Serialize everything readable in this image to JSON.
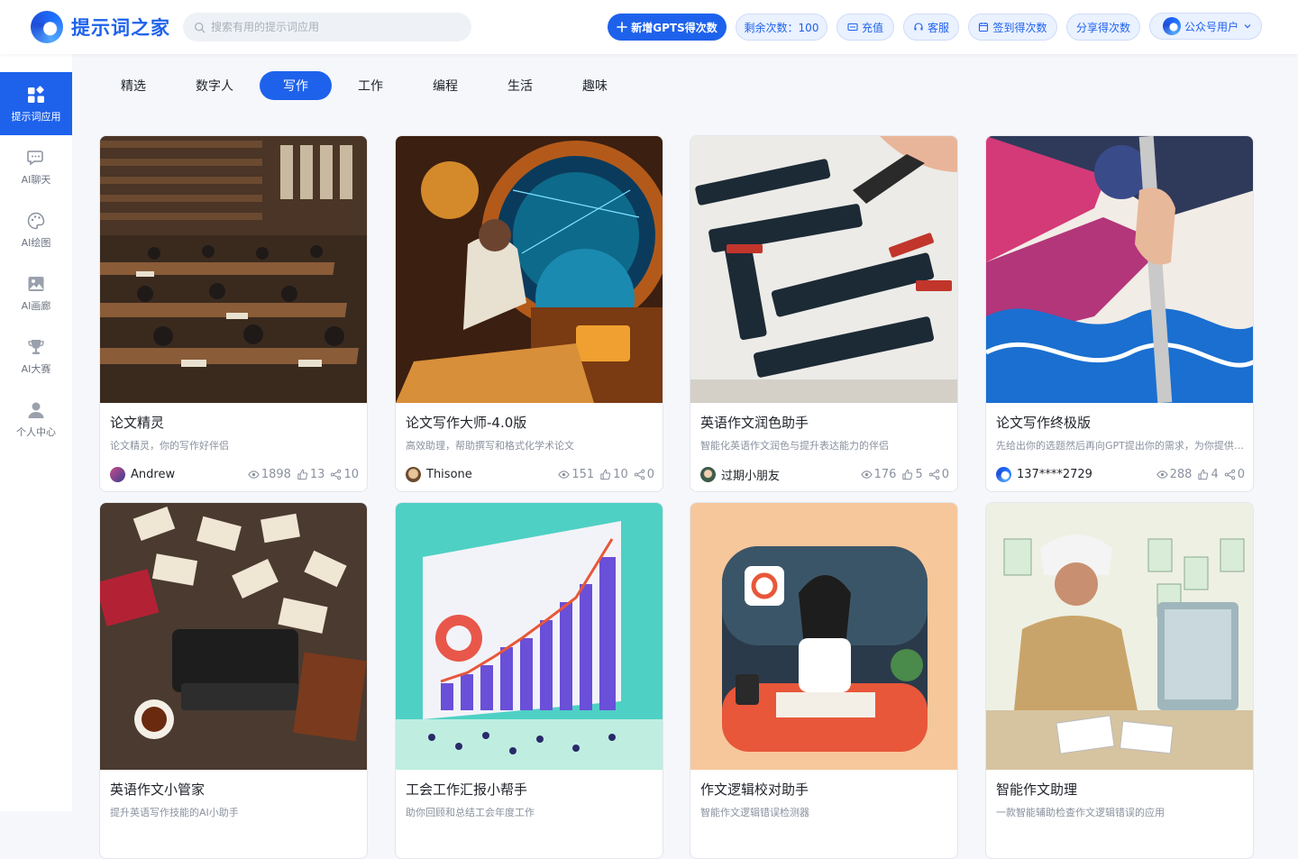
{
  "brand": {
    "name": "提示词之家"
  },
  "search": {
    "placeholder": "搜索有用的提示词应用"
  },
  "header_buttons": {
    "add_gpts": "新增GPTS得次数",
    "remaining": "剩余次数：100",
    "recharge": "充值",
    "service": "客服",
    "checkin": "签到得次数",
    "share": "分享得次数",
    "user": "公众号用户"
  },
  "sidebar": {
    "items": [
      {
        "label": "提示词应用",
        "icon": "grid-icon"
      },
      {
        "label": "AI聊天",
        "icon": "chat-icon"
      },
      {
        "label": "AI绘图",
        "icon": "palette-icon"
      },
      {
        "label": "AI画廊",
        "icon": "gallery-icon"
      },
      {
        "label": "AI大赛",
        "icon": "trophy-icon"
      },
      {
        "label": "个人中心",
        "icon": "person-icon"
      }
    ]
  },
  "tabs": [
    "精选",
    "数字人",
    "写作",
    "工作",
    "编程",
    "生活",
    "趣味"
  ],
  "active_tab": "写作",
  "cards": [
    {
      "title": "论文精灵",
      "desc": "论文精灵，你的写作好伴侣",
      "author": "Andrew",
      "views": "1898",
      "likes": "13",
      "shares": "10"
    },
    {
      "title": "论文写作大师-4.0版",
      "desc": "高效助理，帮助撰写和格式化学术论文",
      "author": "Thisone",
      "views": "151",
      "likes": "10",
      "shares": "0"
    },
    {
      "title": "英语作文润色助手",
      "desc": "智能化英语作文润色与提升表达能力的伴侣",
      "author": "过期小朋友",
      "views": "176",
      "likes": "5",
      "shares": "0"
    },
    {
      "title": "论文写作终极版",
      "desc": "先给出你的选题然后再向GPT提出你的需求，为你提供全方位的论文写作服务",
      "author": "137****2729",
      "views": "288",
      "likes": "4",
      "shares": "0"
    },
    {
      "title": "英语作文小管家",
      "desc": "提升英语写作技能的AI小助手",
      "author": "",
      "views": "",
      "likes": "",
      "shares": ""
    },
    {
      "title": "工会工作汇报小帮手",
      "desc": "助你回顾和总结工会年度工作",
      "author": "",
      "views": "",
      "likes": "",
      "shares": ""
    },
    {
      "title": "作文逻辑校对助手",
      "desc": "智能作文逻辑错误检测器",
      "author": "",
      "views": "",
      "likes": "",
      "shares": ""
    },
    {
      "title": "智能作文助理",
      "desc": "一款智能辅助检查作文逻辑错误的应用",
      "author": "",
      "views": "",
      "likes": "",
      "shares": ""
    }
  ],
  "colors": {
    "primary": "#1e62ec",
    "soft": "#eaf1ff"
  }
}
